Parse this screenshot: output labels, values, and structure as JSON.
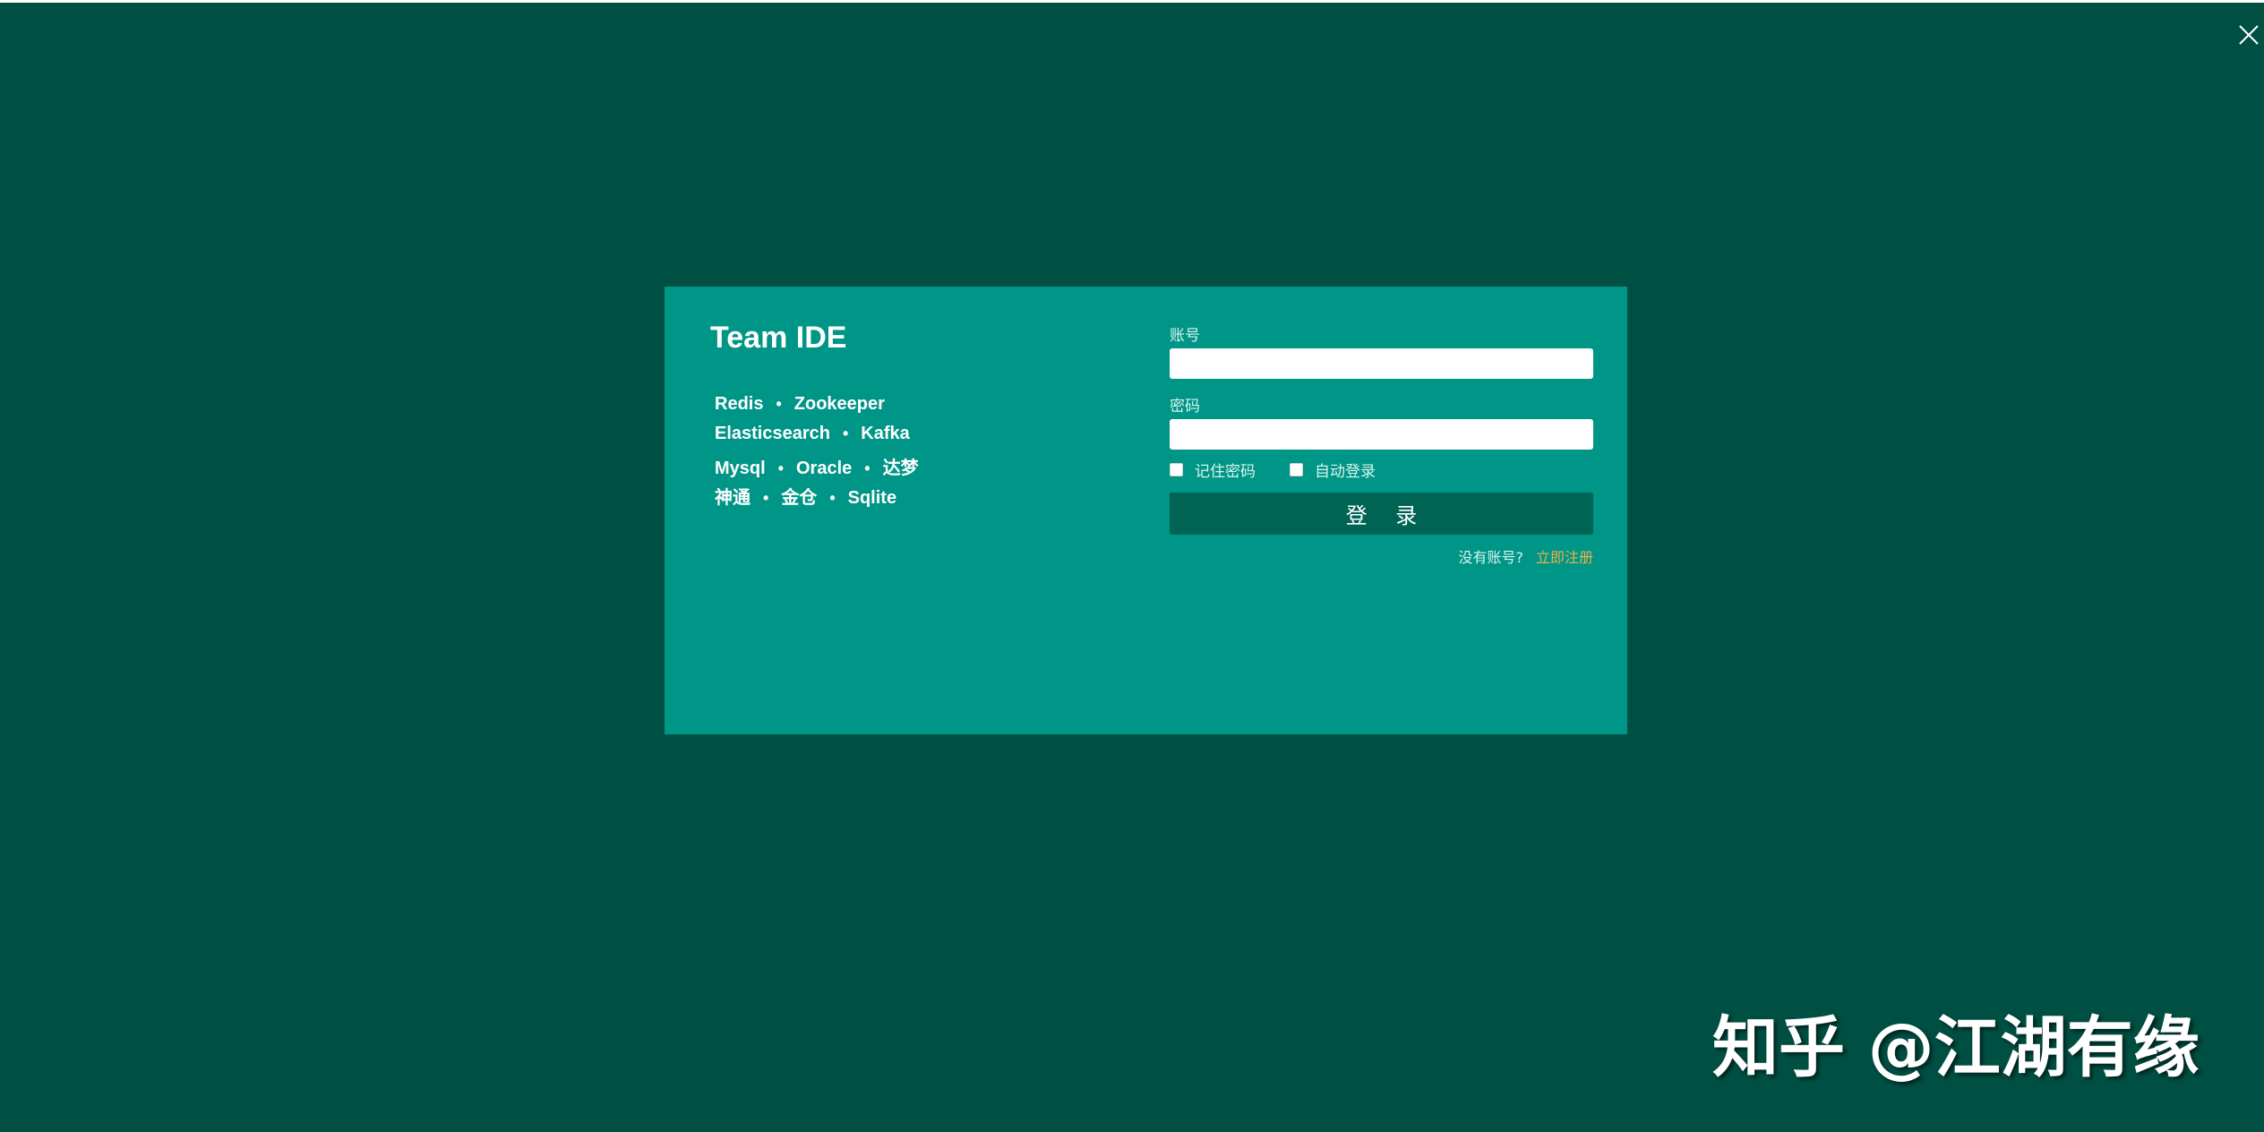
{
  "window": {
    "close_icon": "close-icon"
  },
  "brand": {
    "title": "Team IDE"
  },
  "tech_lines": [
    [
      "Redis",
      "Zookeeper"
    ],
    [
      "Elasticsearch",
      "Kafka"
    ],
    [
      "Mysql",
      "Oracle",
      "达梦"
    ],
    [
      "神通",
      "金仓",
      "Sqlite"
    ]
  ],
  "form": {
    "account_label": "账号",
    "account_value": "",
    "password_label": "密码",
    "password_value": "",
    "remember_label": "记住密码",
    "auto_login_label": "自动登录",
    "login_button": "登 录",
    "no_account_text": "没有账号?",
    "register_link": "立即注册"
  },
  "watermark": {
    "text": "知乎 @江湖有缘"
  },
  "colors": {
    "background": "#004f43",
    "card": "#009687",
    "button": "#006454",
    "link": "#e8b24a"
  }
}
